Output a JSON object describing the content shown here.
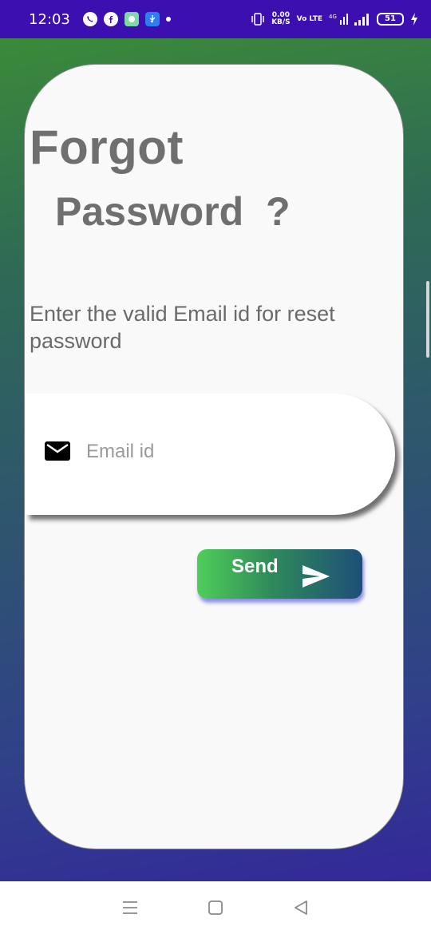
{
  "status_bar": {
    "time": "12:03",
    "icons": [
      "whatsapp-icon",
      "facebook-icon",
      "chat-app-icon",
      "usb-icon",
      "notification-dot"
    ],
    "net_speed_top": "0.00",
    "net_speed_bottom": "KB/S",
    "network_labels": [
      "Vo LTE",
      "4G"
    ],
    "battery": "51",
    "colors": {
      "bar": "#3b0fb0"
    }
  },
  "screen": {
    "title_line1": "Forgot",
    "title_line2": "Password  ?",
    "instructions": "Enter the valid Email id for reset password",
    "email_field": {
      "placeholder": "Email id",
      "value": "",
      "icon": "mail-icon"
    },
    "send_button": {
      "label": "Send",
      "icon": "send-arrow-icon"
    }
  },
  "nav_bar": {
    "buttons": [
      "menu-icon",
      "home-icon",
      "back-icon"
    ]
  },
  "colors": {
    "gradient_top": "#3b8a3a",
    "gradient_bottom": "#34289a",
    "card": "#f9f9f9",
    "title_text": "#6f6f6f",
    "button_start": "#4fce5a",
    "button_end": "#1d4f78"
  }
}
